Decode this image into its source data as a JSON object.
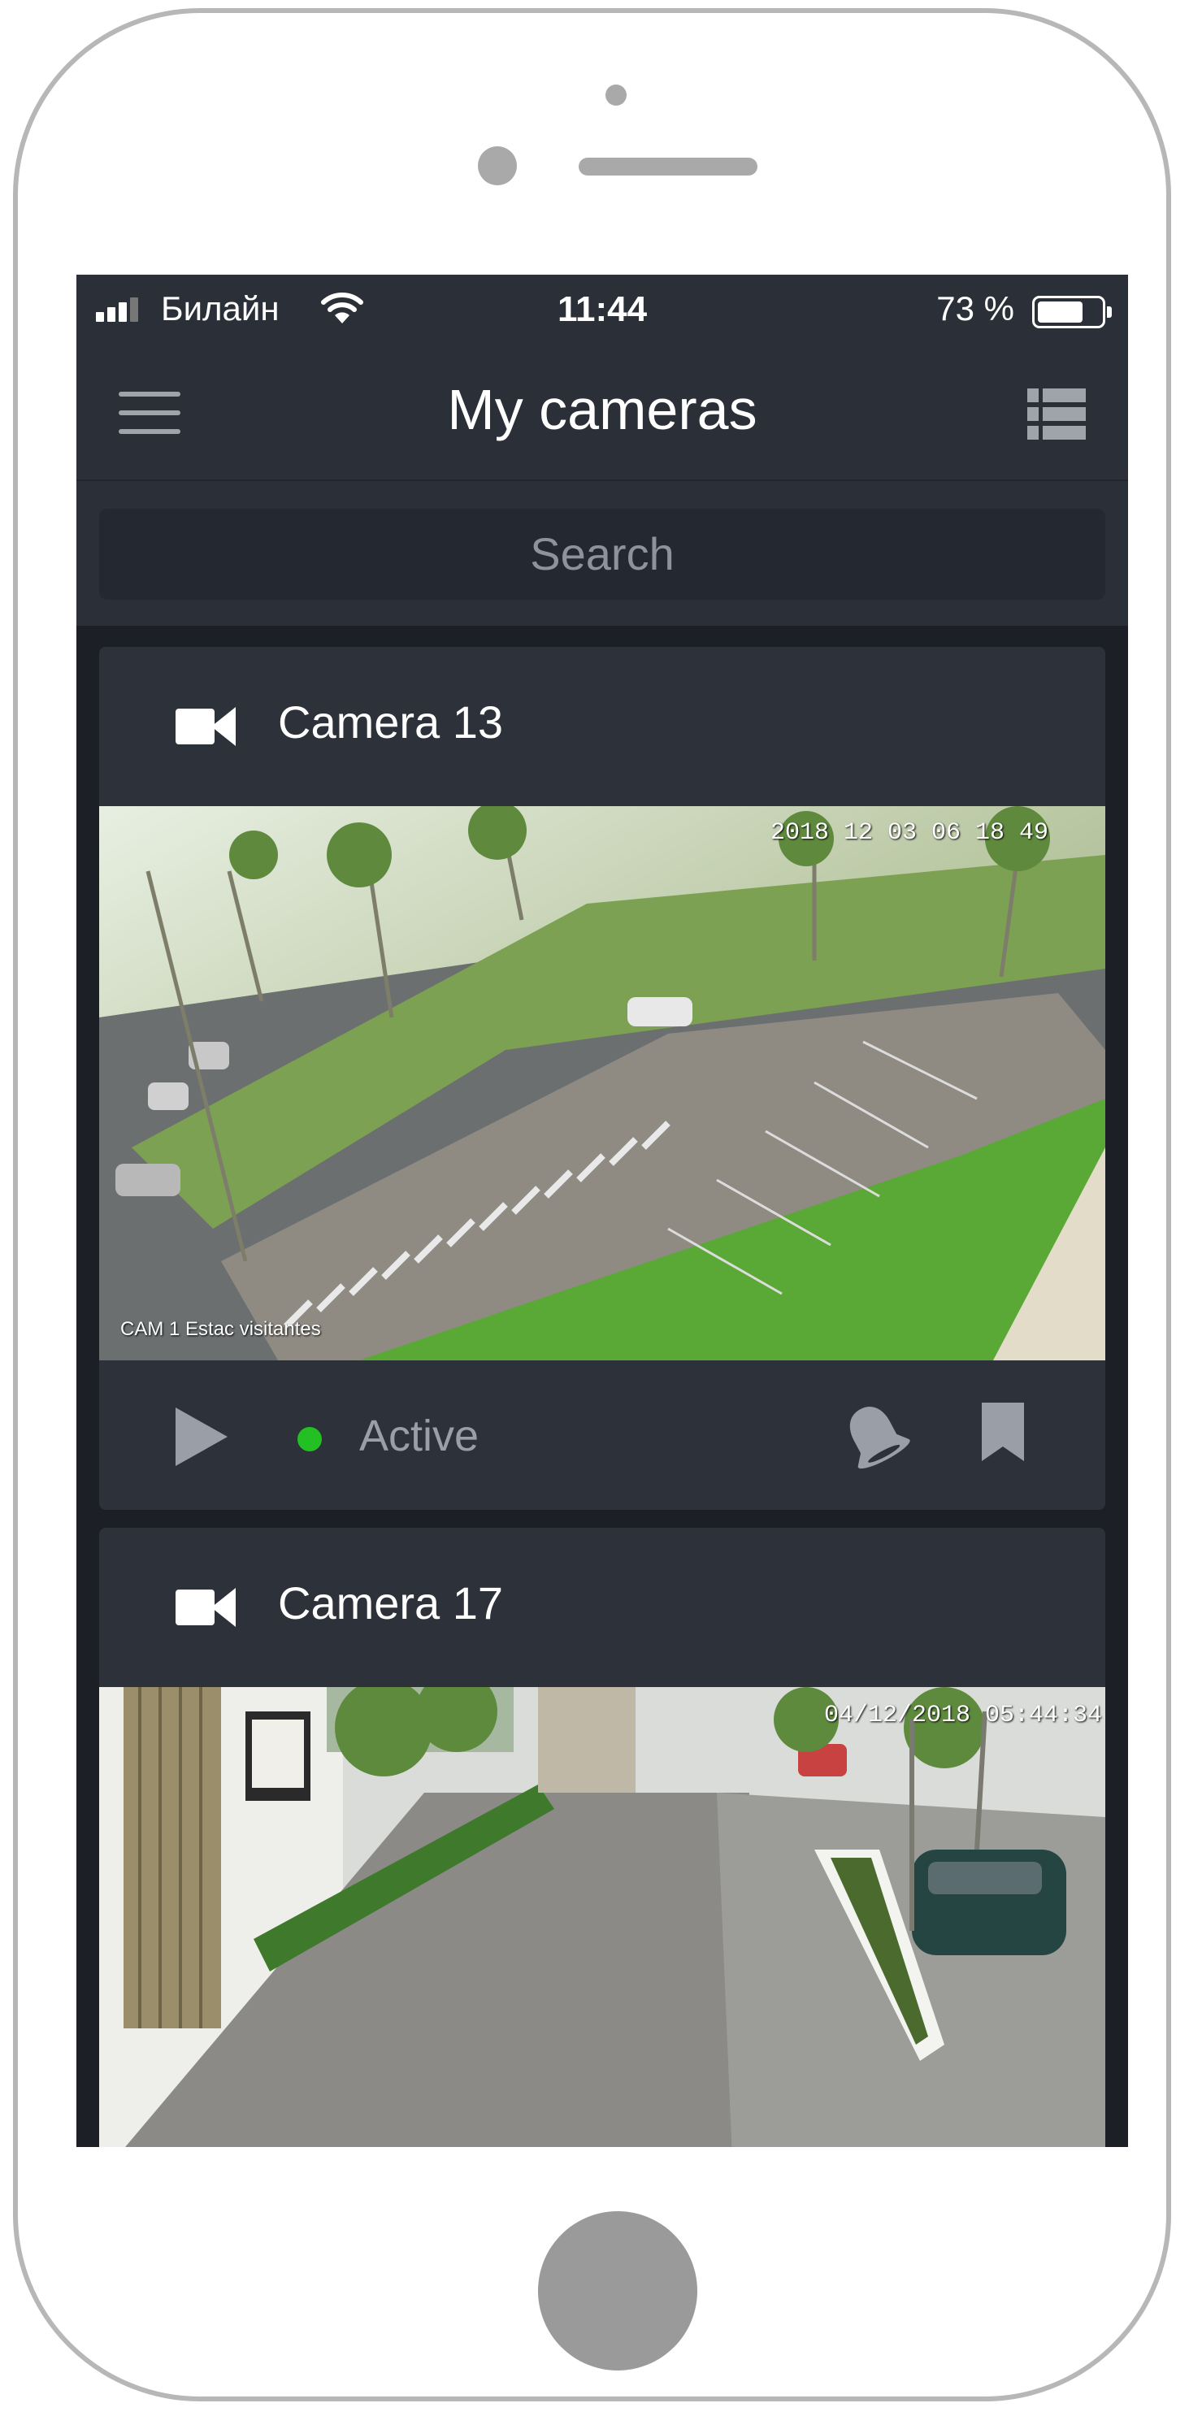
{
  "status_bar": {
    "carrier": "Билайн",
    "time": "11:44",
    "battery_percent": "73 %",
    "battery_level": 0.73
  },
  "nav": {
    "title": "My cameras"
  },
  "search": {
    "placeholder": "Search"
  },
  "cameras": [
    {
      "name": "Camera 13",
      "feed_timestamp": "2018 12 03 06 18 49",
      "feed_label": "CAM 1 Estac visitantes",
      "status": "Active",
      "status_color": "#22c022"
    },
    {
      "name": "Camera 17",
      "feed_timestamp": "04/12/2018 05:44:34"
    }
  ],
  "colors": {
    "screen_background": "#1c1f26",
    "header_background": "#2b2f38",
    "card_background": "#2d313a",
    "icon_gray": "#9a9ea6"
  },
  "icons": [
    "signal-icon",
    "wifi-icon",
    "battery-icon",
    "menu-icon",
    "list-view-icon",
    "video-camera-icon",
    "play-icon",
    "bell-icon",
    "bookmark-icon"
  ]
}
